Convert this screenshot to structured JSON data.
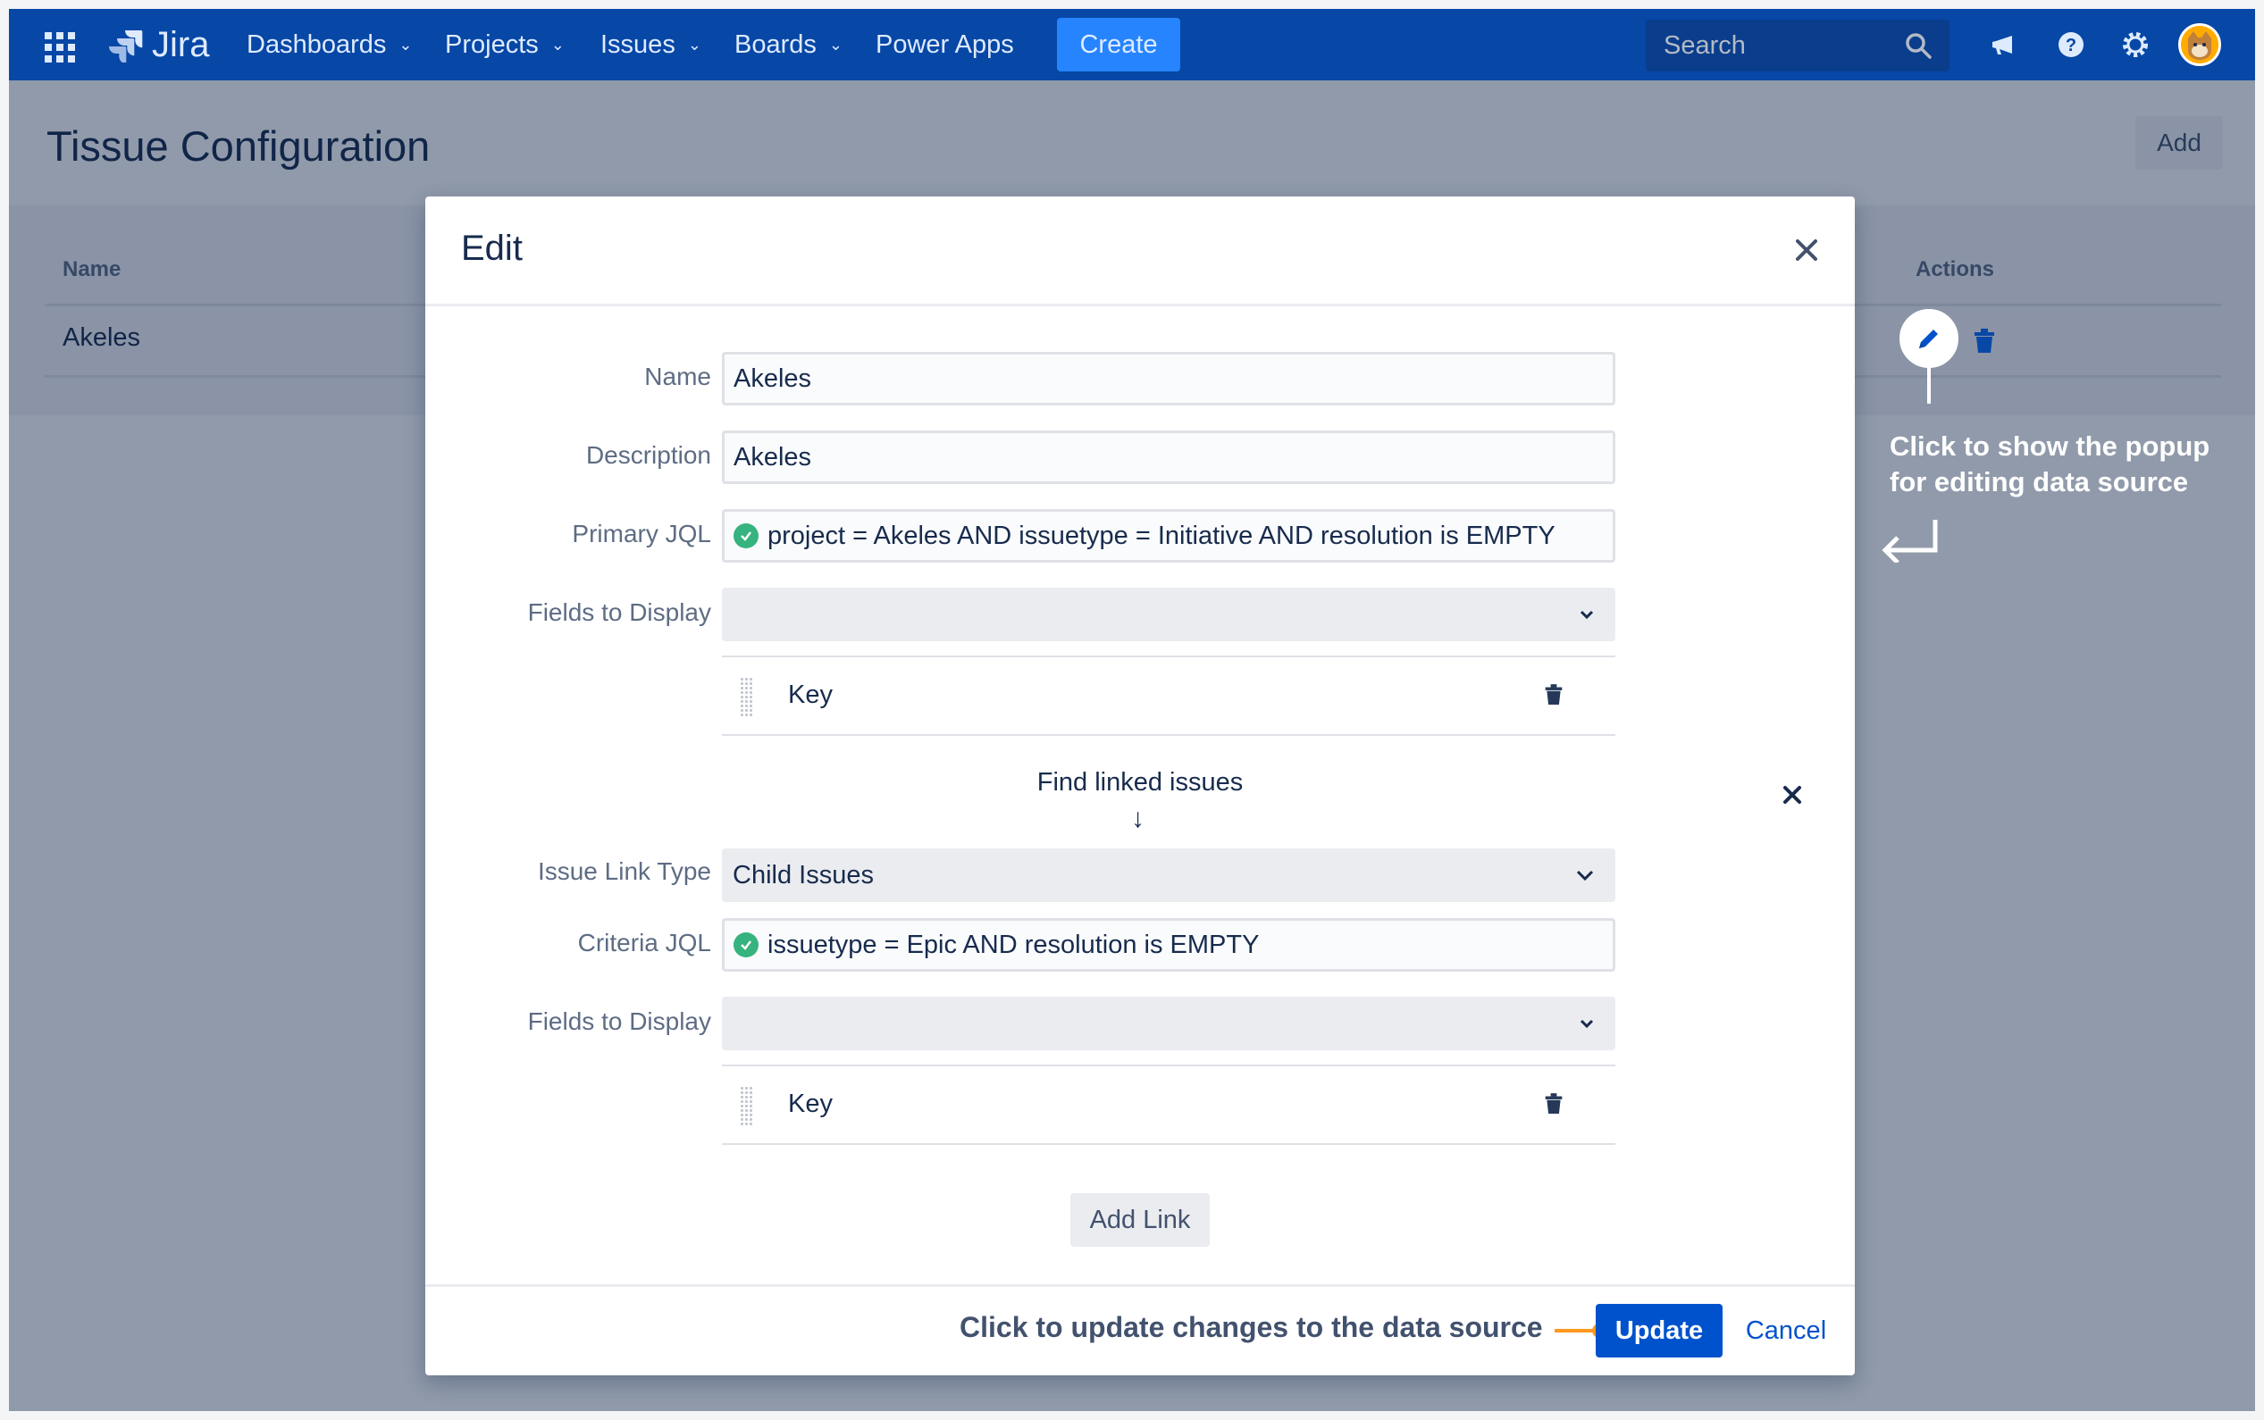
{
  "nav": {
    "logo": "Jira",
    "items": [
      {
        "label": "Dashboards",
        "has_dropdown": true
      },
      {
        "label": "Projects",
        "has_dropdown": true
      },
      {
        "label": "Issues",
        "has_dropdown": true
      },
      {
        "label": "Boards",
        "has_dropdown": true
      },
      {
        "label": "Power Apps",
        "has_dropdown": false
      }
    ],
    "create_label": "Create",
    "search_placeholder": "Search",
    "icons": [
      "apps-grid-icon",
      "megaphone-icon",
      "help-icon",
      "settings-icon",
      "avatar"
    ]
  },
  "page": {
    "title": "Tissue Configuration",
    "add_label": "Add",
    "table": {
      "columns": [
        "Name",
        "Actions"
      ],
      "rows": [
        {
          "name": "Akeles"
        }
      ]
    }
  },
  "callouts": {
    "edit_hint": "Click to show the popup for editing data source",
    "update_hint": "Click to update changes to the data source"
  },
  "modal": {
    "title": "Edit",
    "fields": {
      "name_label": "Name",
      "name_value": "Akeles",
      "description_label": "Description",
      "description_value": "Akeles",
      "primary_jql_label": "Primary JQL",
      "primary_jql_value": "project = Akeles AND issuetype = Initiative AND resolution is EMPTY",
      "fields_display_label": "Fields to Display",
      "fields_display_item": "Key"
    },
    "link": {
      "section_label": "Find linked issues",
      "arrow": "↓",
      "link_type_label": "Issue Link Type",
      "link_type_value": "Child Issues",
      "criteria_jql_label": "Criteria JQL",
      "criteria_jql_value": "issuetype = Epic AND resolution is EMPTY",
      "fields_display_label": "Fields to Display",
      "fields_display_item": "Key"
    },
    "add_link_label": "Add Link",
    "update_label": "Update",
    "cancel_label": "Cancel"
  },
  "colors": {
    "nav_bg": "#0747a6",
    "primary": "#0052cc",
    "success": "#36b37e",
    "accent": "#ff991f"
  }
}
